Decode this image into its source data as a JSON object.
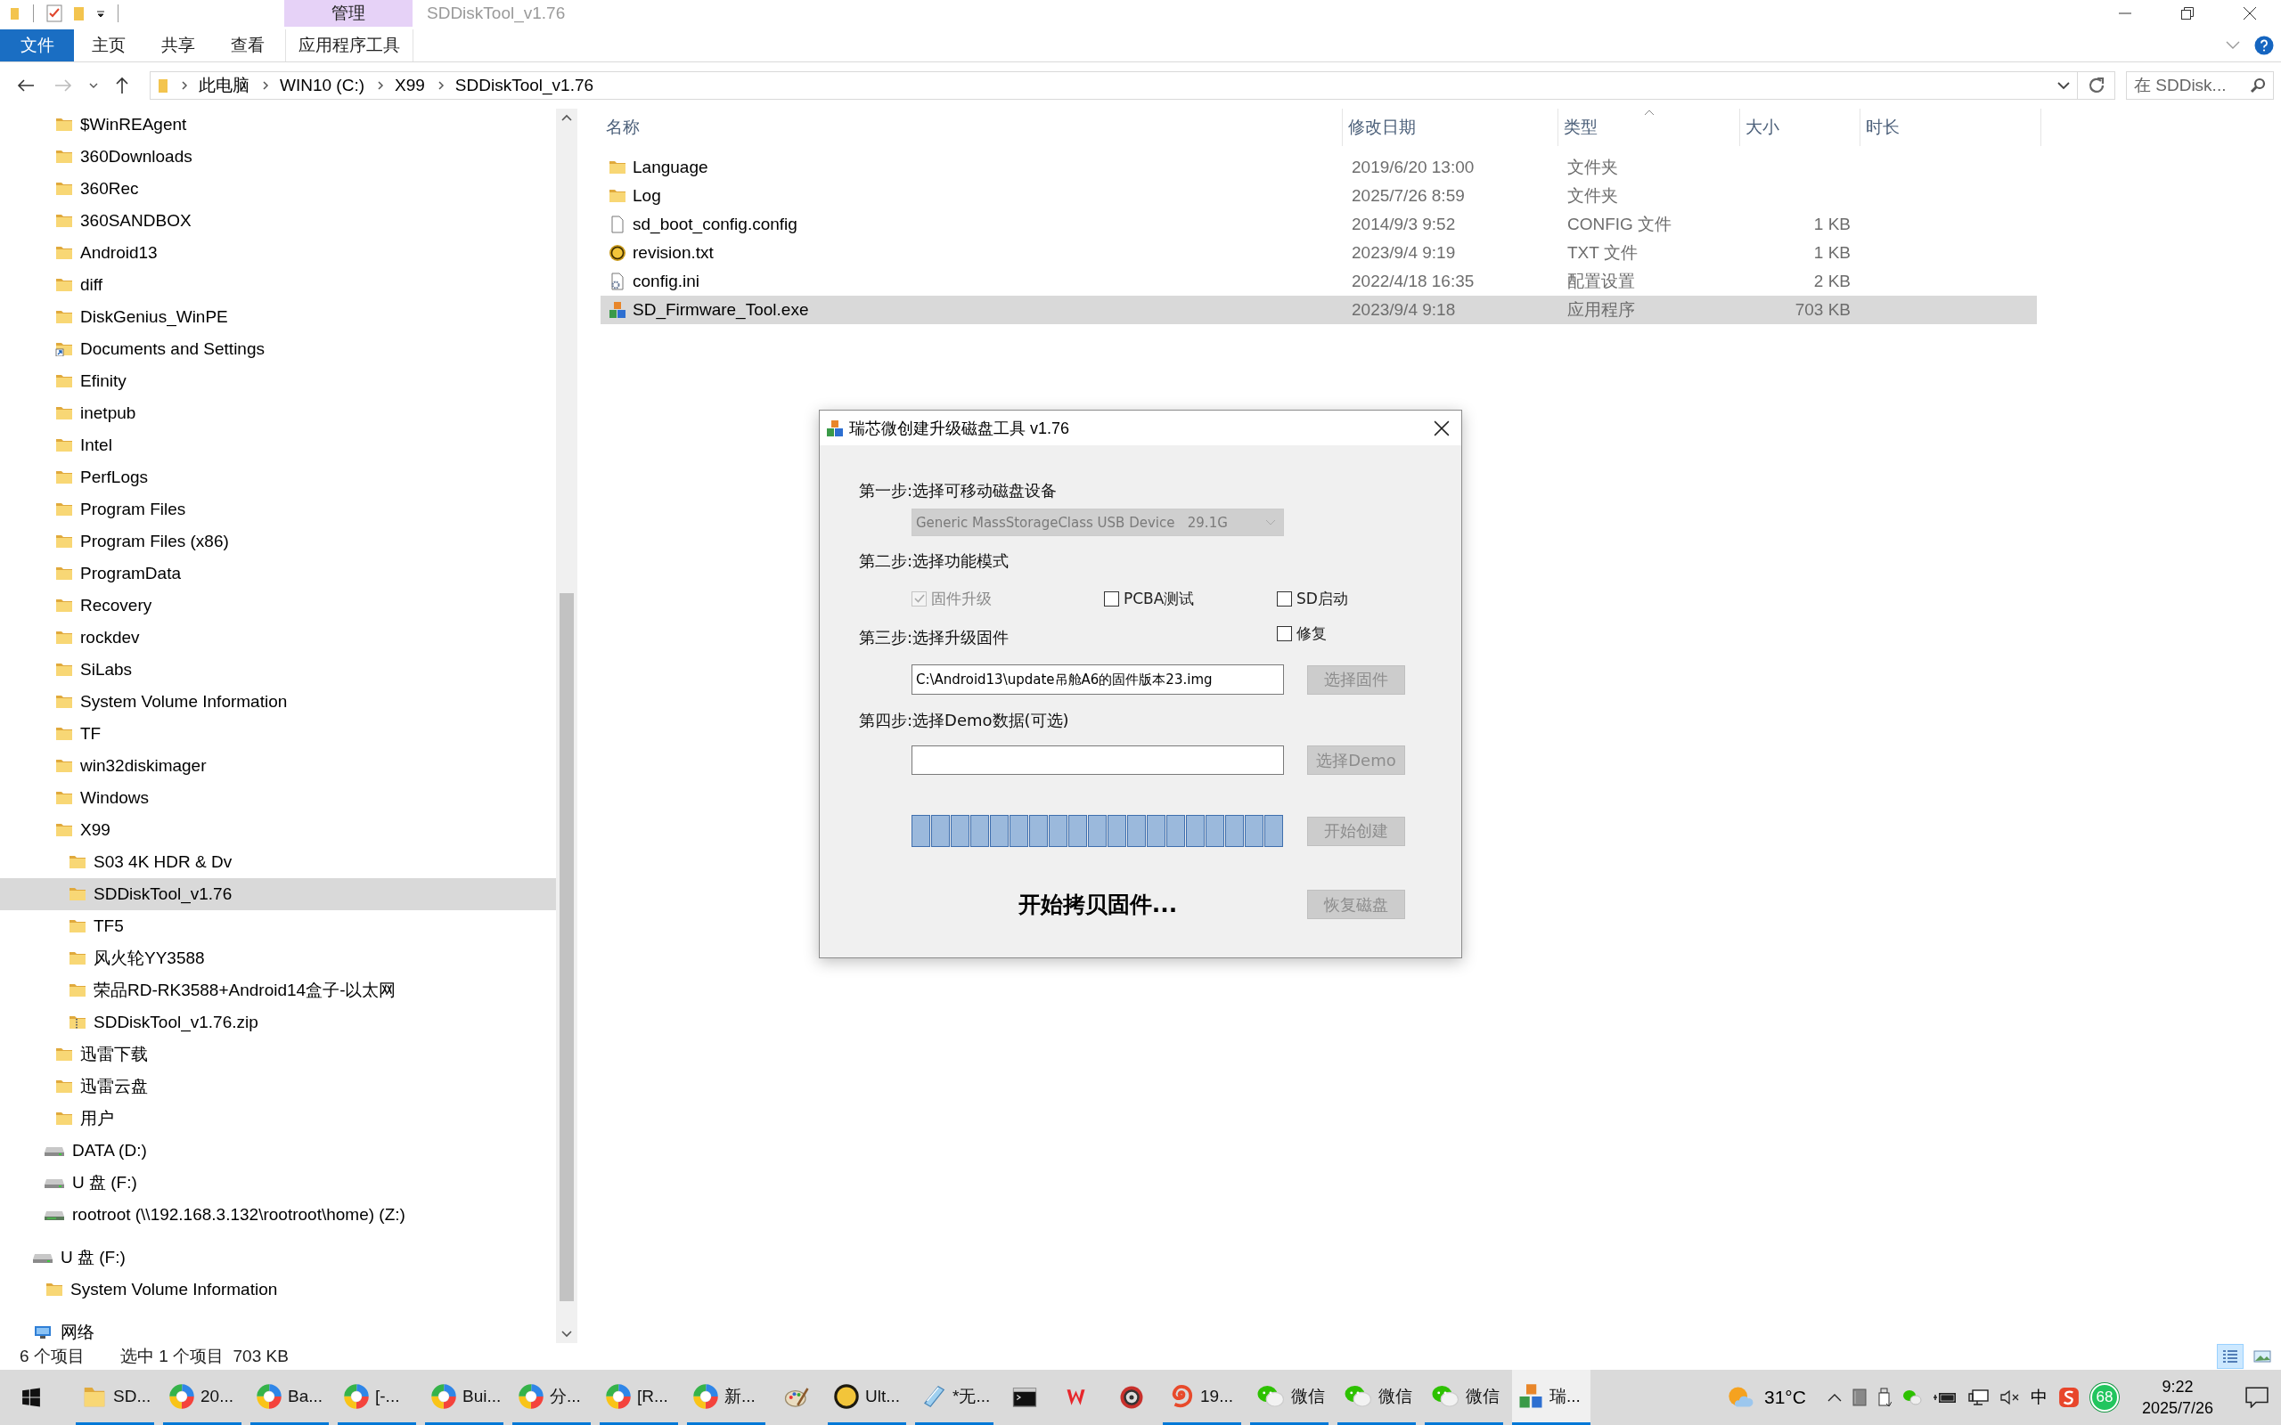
{
  "window": {
    "context_tab_group": "管理",
    "title": "SDDiskTool_v1.76"
  },
  "ribbon_tabs": [
    {
      "label": "文件",
      "kind": "file-menu",
      "selected": false
    },
    {
      "label": "主页",
      "kind": "tab",
      "selected": false
    },
    {
      "label": "共享",
      "kind": "tab",
      "selected": false
    },
    {
      "label": "查看",
      "kind": "tab",
      "selected": false
    },
    {
      "label": "应用程序工具",
      "kind": "context-tab",
      "selected": false
    }
  ],
  "navigation": {
    "back_disabled": false,
    "forward_disabled": true
  },
  "address_bar": {
    "breadcrumbs": [
      "此电脑",
      "WIN10 (C:)",
      "X99",
      "SDDiskTool_v1.76"
    ]
  },
  "search": {
    "placeholder": "在 SDDisk..."
  },
  "sidebar": {
    "folders": [
      {
        "label": "$WinREAgent",
        "kind": "folder",
        "selected": false
      },
      {
        "label": "360Downloads",
        "kind": "folder",
        "selected": false
      },
      {
        "label": "360Rec",
        "kind": "folder",
        "selected": false
      },
      {
        "label": "360SANDBOX",
        "kind": "folder",
        "selected": false
      },
      {
        "label": "Android13",
        "kind": "folder",
        "selected": false
      },
      {
        "label": "diff",
        "kind": "folder",
        "selected": false
      },
      {
        "label": "DiskGenius_WinPE",
        "kind": "folder",
        "selected": false
      },
      {
        "label": "Documents and Settings",
        "kind": "shortcut",
        "selected": false
      },
      {
        "label": "Efinity",
        "kind": "folder",
        "selected": false
      },
      {
        "label": "inetpub",
        "kind": "folder",
        "selected": false
      },
      {
        "label": "Intel",
        "kind": "folder",
        "selected": false
      },
      {
        "label": "PerfLogs",
        "kind": "folder",
        "selected": false
      },
      {
        "label": "Program Files",
        "kind": "folder",
        "selected": false
      },
      {
        "label": "Program Files (x86)",
        "kind": "folder",
        "selected": false
      },
      {
        "label": "ProgramData",
        "kind": "folder",
        "selected": false
      },
      {
        "label": "Recovery",
        "kind": "folder",
        "selected": false
      },
      {
        "label": "rockdev",
        "kind": "folder",
        "selected": false
      },
      {
        "label": "SiLabs",
        "kind": "folder",
        "selected": false
      },
      {
        "label": "System Volume Information",
        "kind": "folder",
        "selected": false
      },
      {
        "label": "TF",
        "kind": "folder",
        "selected": false
      },
      {
        "label": "win32diskimager",
        "kind": "folder",
        "selected": false
      },
      {
        "label": "Windows",
        "kind": "folder",
        "selected": false
      },
      {
        "label": "X99",
        "kind": "folder",
        "selected": false,
        "children": [
          {
            "label": "S03 4K HDR & Dv",
            "kind": "folder",
            "selected": false
          },
          {
            "label": "SDDiskTool_v1.76",
            "kind": "folder",
            "selected": true
          },
          {
            "label": "TF5",
            "kind": "folder",
            "selected": false
          },
          {
            "label": "风火轮YY3588",
            "kind": "folder",
            "selected": false
          },
          {
            "label": "荣品RD-RK3588+Android14盒子-以太网",
            "kind": "folder",
            "selected": false
          },
          {
            "label": "SDDiskTool_v1.76.zip",
            "kind": "zip",
            "selected": false
          }
        ]
      },
      {
        "label": "迅雷下载",
        "kind": "folder",
        "selected": false
      },
      {
        "label": "迅雷云盘",
        "kind": "folder",
        "selected": false
      },
      {
        "label": "用户",
        "kind": "folder",
        "selected": false
      }
    ],
    "drives": [
      {
        "label": "DATA (D:)",
        "kind": "drive",
        "selected": false
      },
      {
        "label": "U 盘 (F:)",
        "kind": "drive",
        "selected": false
      },
      {
        "label": "rootroot (\\\\192.168.3.132\\rootroot\\home) (Z:)",
        "kind": "network-drive",
        "selected": false
      }
    ],
    "devices": [
      {
        "label": "U 盘 (F:)",
        "kind": "drive",
        "selected": false,
        "children": [
          {
            "label": "System Volume Information",
            "kind": "folder",
            "selected": false
          }
        ]
      }
    ],
    "network": [
      {
        "label": "网络",
        "kind": "network",
        "selected": false
      }
    ]
  },
  "file_list": {
    "columns": [
      {
        "label": "名称",
        "sorted": false
      },
      {
        "label": "修改日期",
        "sorted": false
      },
      {
        "label": "类型",
        "sorted": true
      },
      {
        "label": "大小",
        "sorted": false
      },
      {
        "label": "时长",
        "sorted": false
      }
    ],
    "rows": [
      {
        "name": "Language",
        "kind": "folder",
        "date": "2019/6/20 13:00",
        "type": "文件夹",
        "selected": false
      },
      {
        "name": "Log",
        "kind": "folder",
        "date": "2025/7/26 8:59",
        "type": "文件夹",
        "selected": false
      },
      {
        "name": "sd_boot_config.config",
        "kind": "file",
        "date": "2014/9/3 9:52",
        "type": "CONFIG 文件",
        "size": "1 KB",
        "selected": false
      },
      {
        "name": "revision.txt",
        "kind": "badge",
        "date": "2023/9/4 9:19",
        "type": "TXT 文件",
        "size": "1 KB",
        "selected": false
      },
      {
        "name": "config.ini",
        "kind": "config",
        "date": "2022/4/18 16:35",
        "type": "配置设置",
        "size": "2 KB",
        "selected": false
      },
      {
        "name": "SD_Firmware_Tool.exe",
        "kind": "app",
        "date": "2023/9/4 9:18",
        "type": "应用程序",
        "size": "703 KB",
        "selected": true
      }
    ]
  },
  "dialog": {
    "title": "瑞芯微创建升级磁盘工具 v1.76",
    "step1_label": "第一步:选择可移动磁盘设备",
    "device_select": {
      "value": "Generic MassStorageClass USB Device   29.1G",
      "disabled": true
    },
    "step2_label": "第二步:选择功能模式",
    "modes": [
      {
        "label": "固件升级",
        "checked": true,
        "disabled": true
      },
      {
        "label": "PCBA测试",
        "checked": false,
        "disabled": false
      },
      {
        "label": "SD启动",
        "checked": false,
        "disabled": false
      },
      {
        "label": "修复",
        "checked": false,
        "disabled": false
      }
    ],
    "step3_label": "第三步:选择升级固件",
    "firmware_path": {
      "value": "C:\\Android13\\update吊舱A6的固件版本23.img"
    },
    "choose_firmware_button": {
      "label": "选择固件",
      "disabled": true
    },
    "step4_label": "第四步:选择Demo数据(可选)",
    "choose_demo_button": {
      "label": "选择Demo",
      "disabled": true
    },
    "progress": {
      "level": 1
    },
    "create_button": {
      "label": "开始创建",
      "disabled": true
    },
    "status_text": "开始拷贝固件...",
    "restore_button": {
      "label": "恢复磁盘",
      "disabled": true
    }
  },
  "status_bar": {
    "item_count": "6 个项目",
    "selection": "选中 1 个项目  703 KB",
    "view_buttons": [
      {
        "kind": "details",
        "selected": true
      },
      {
        "kind": "large-icons",
        "selected": false
      }
    ]
  },
  "taskbar": {
    "items": [
      {
        "label": "SD...",
        "kind": "folder",
        "running": true,
        "active": false
      },
      {
        "label": "20...",
        "kind": "wheel",
        "running": true,
        "active": false
      },
      {
        "label": "Ba...",
        "kind": "wheel",
        "running": true,
        "active": false
      },
      {
        "label": "[-...",
        "kind": "wheel",
        "running": true,
        "active": false
      },
      {
        "label": "Bui...",
        "kind": "wheel",
        "running": true,
        "active": false
      },
      {
        "label": "分...",
        "kind": "wheel",
        "running": true,
        "active": false
      },
      {
        "label": "[R...",
        "kind": "wheel",
        "running": true,
        "active": false
      },
      {
        "label": "新...",
        "kind": "wheel",
        "running": true,
        "active": false
      },
      {
        "kind": "palette",
        "running": false,
        "active": false
      },
      {
        "label": "Ult...",
        "kind": "badge",
        "running": true,
        "active": false
      },
      {
        "label": "*无...",
        "kind": "notepad",
        "running": true,
        "active": false
      },
      {
        "kind": "terminal",
        "running": false,
        "active": false
      },
      {
        "kind": "wps",
        "running": false,
        "active": false
      },
      {
        "kind": "disc",
        "running": false,
        "active": false
      },
      {
        "label": "19...",
        "kind": "swirl",
        "running": true,
        "active": false
      },
      {
        "label": "微信",
        "kind": "chat",
        "running": true,
        "active": false
      },
      {
        "label": "微信",
        "kind": "chat",
        "running": true,
        "active": false
      },
      {
        "label": "微信",
        "kind": "chat",
        "running": true,
        "active": false
      },
      {
        "label": "瑞...",
        "kind": "blocks",
        "running": true,
        "active": true
      }
    ],
    "weather": "31°C",
    "ime": "中",
    "security_score": "68",
    "time": "9:22",
    "date": "2025/7/26"
  }
}
